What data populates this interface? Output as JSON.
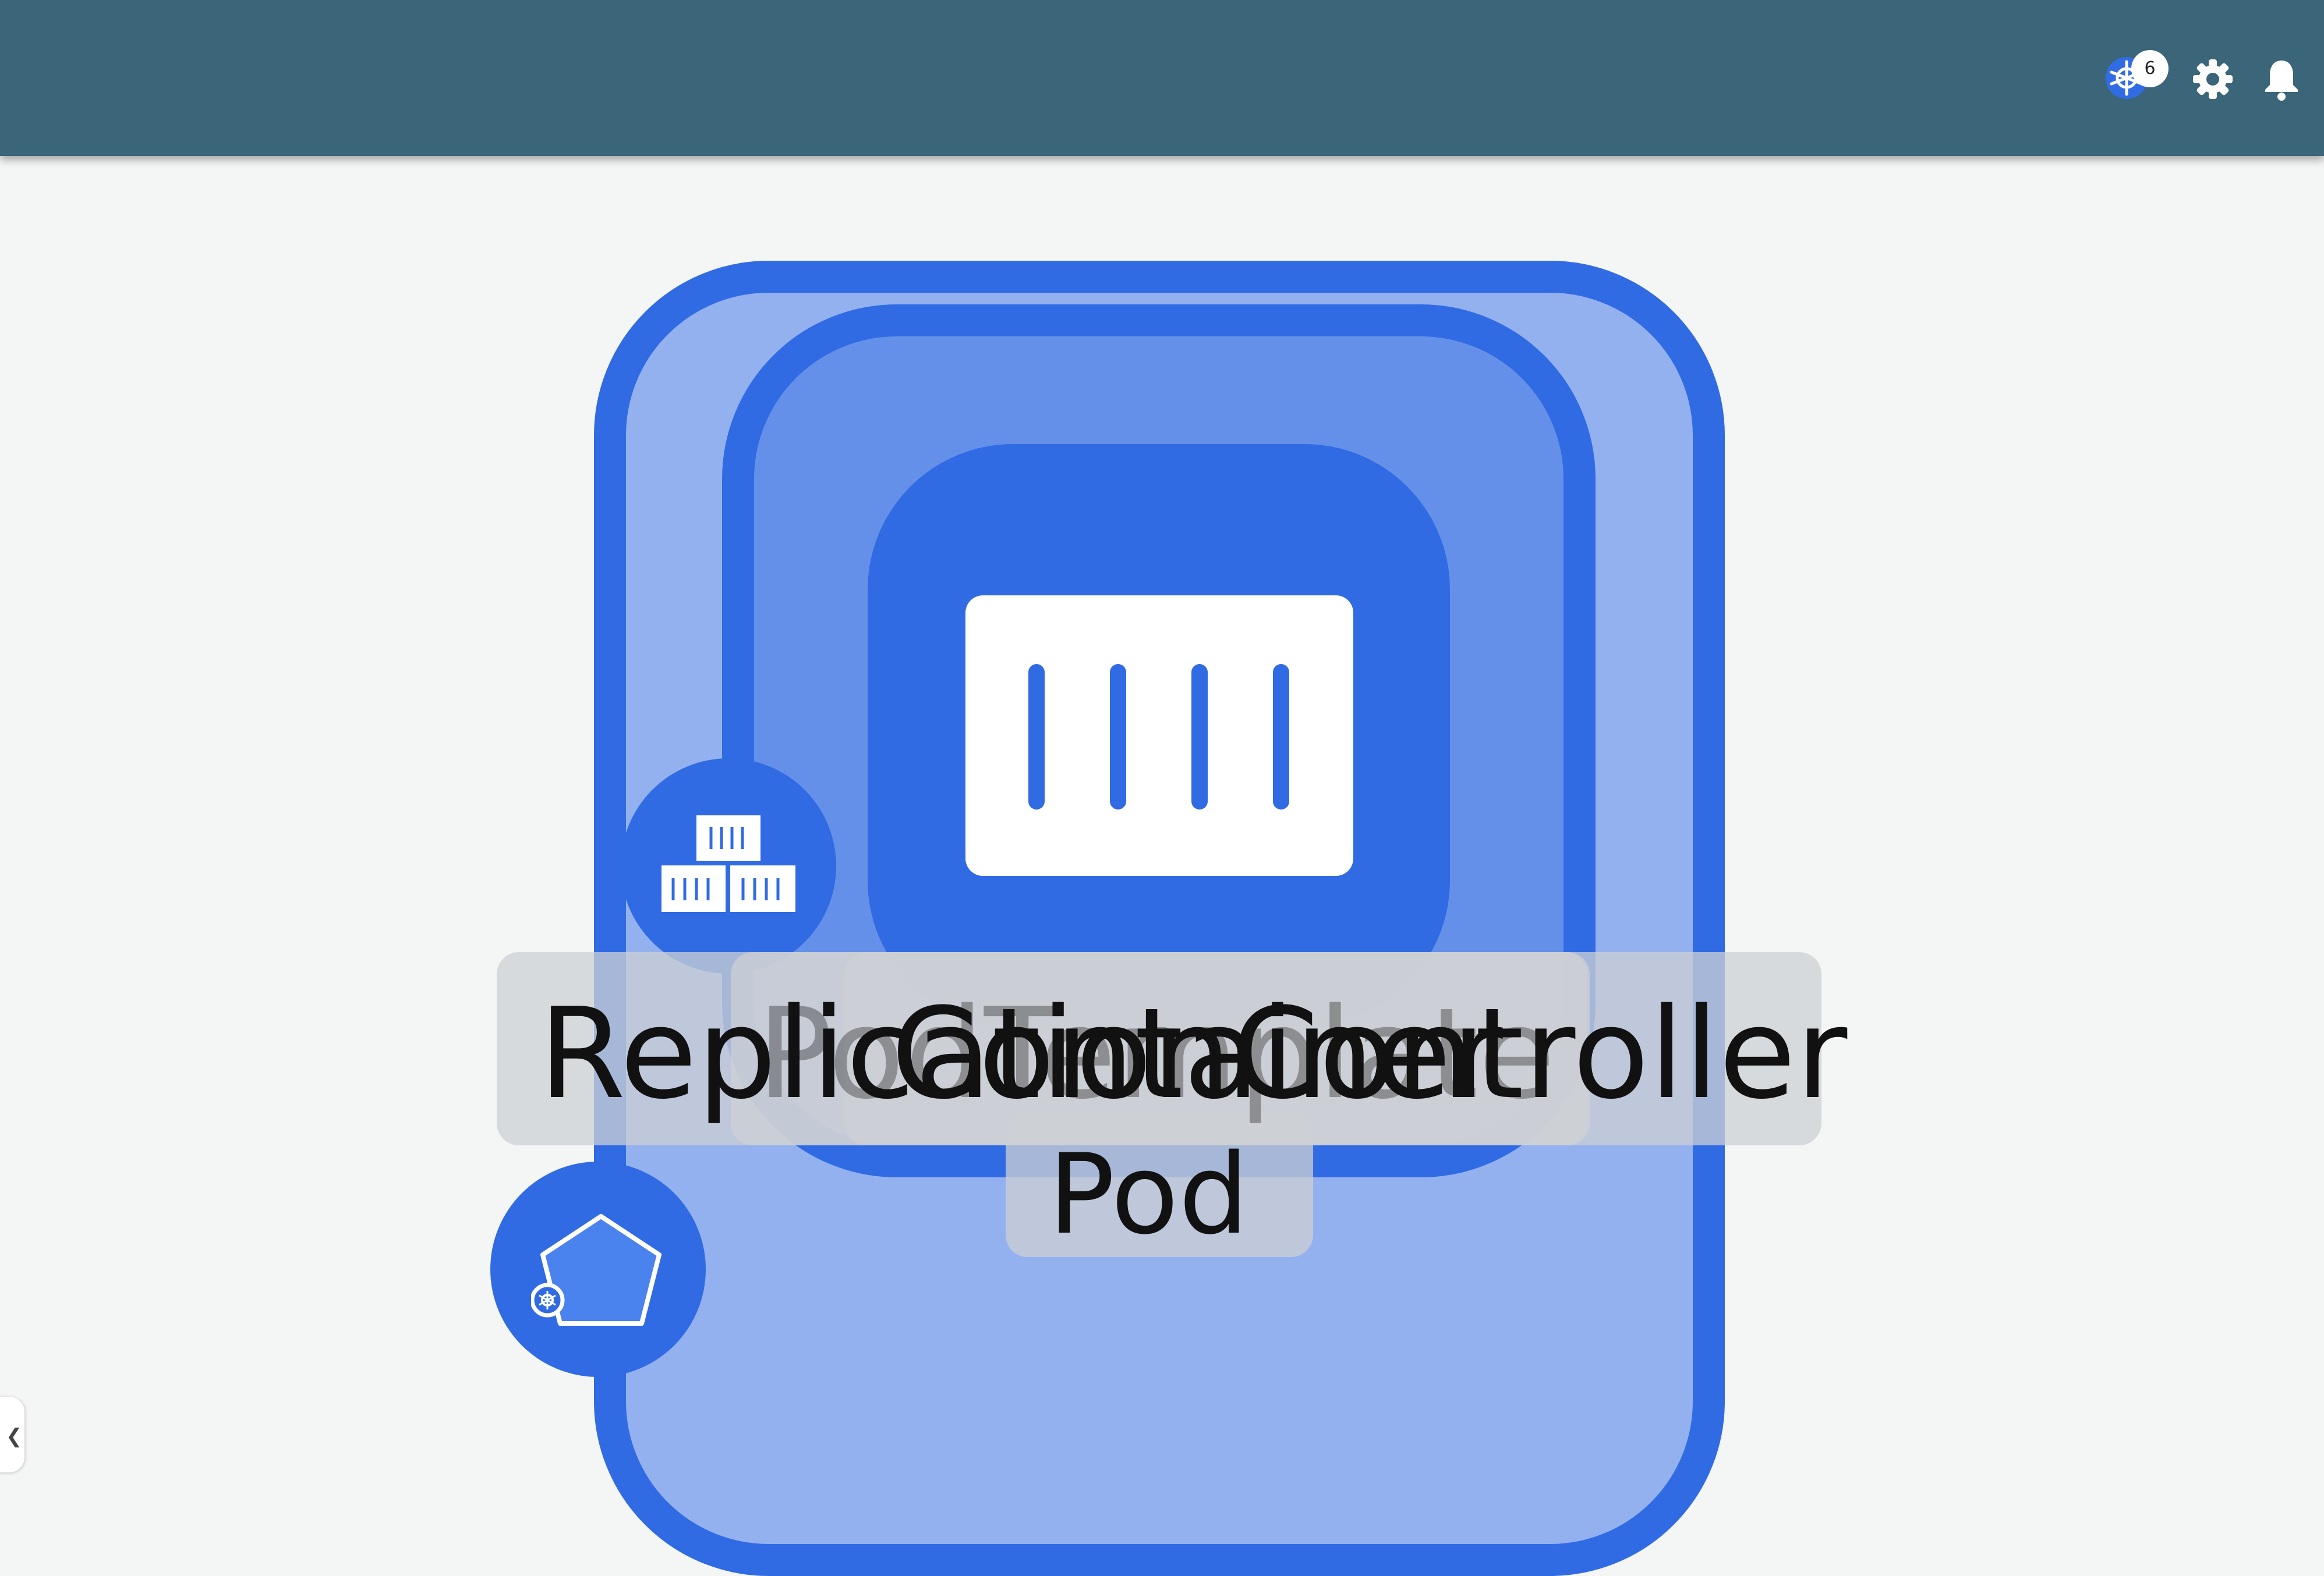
{
  "header": {
    "k8s_badge_count": "6",
    "icons": [
      "kubernetes-icon",
      "gear-icon",
      "bell-icon"
    ],
    "background_color": "#3b6578"
  },
  "diagram": {
    "labels": {
      "replication_controller": "ReplicationController",
      "container": "Container",
      "pod_template": "PodTemplate",
      "pod": "Pod"
    },
    "colors": {
      "primary": "#306be3",
      "pod_fill": "#94b1ef",
      "container_area_fill": "#6490e9"
    }
  },
  "sidebar": {
    "collapse_icon": "chevron-left-icon"
  }
}
